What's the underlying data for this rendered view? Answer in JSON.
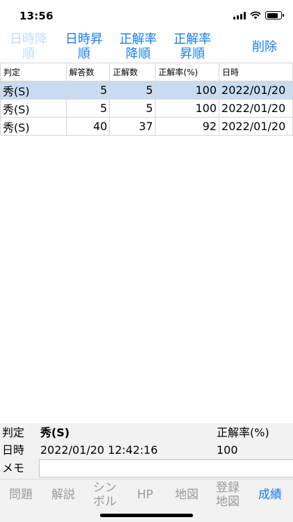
{
  "status": {
    "time": "13:56"
  },
  "toolbar": {
    "sort_date_desc": "日時降\n順",
    "sort_date_asc": "日時昇\n順",
    "sort_rate_desc": "正解率\n降順",
    "sort_rate_asc": "正解率\n昇順",
    "delete": "削除"
  },
  "table": {
    "headers": [
      "判定",
      "解答数",
      "正解数",
      "正解率(%)",
      "日時"
    ],
    "rows": [
      {
        "judge": "秀(S)",
        "answered": "5",
        "correct": "5",
        "rate": "100",
        "date": "2022/01/20"
      },
      {
        "judge": "秀(S)",
        "answered": "5",
        "correct": "5",
        "rate": "100",
        "date": "2022/01/20"
      },
      {
        "judge": "秀(S)",
        "answered": "40",
        "correct": "37",
        "rate": "92",
        "date": "2022/01/20"
      }
    ]
  },
  "detail": {
    "judge_label": "判定",
    "judge_value": "秀(S)",
    "rate_label": "正解率(%)",
    "date_label": "日時",
    "date_value": "2022/01/20 12:42:16",
    "rate_value": "100",
    "memo_label": "メモ",
    "memo_value": ""
  },
  "tabs": {
    "problem": "問題",
    "explain": "解説",
    "symbol": "シン\nボル",
    "hp": "HP",
    "map": "地図",
    "regmap": "登録\n地図",
    "results": "成績"
  },
  "colors": {
    "accent": "#1a7cf0",
    "selected_row": "#c9dcef",
    "inactive_tab": "#9a9a9a"
  }
}
